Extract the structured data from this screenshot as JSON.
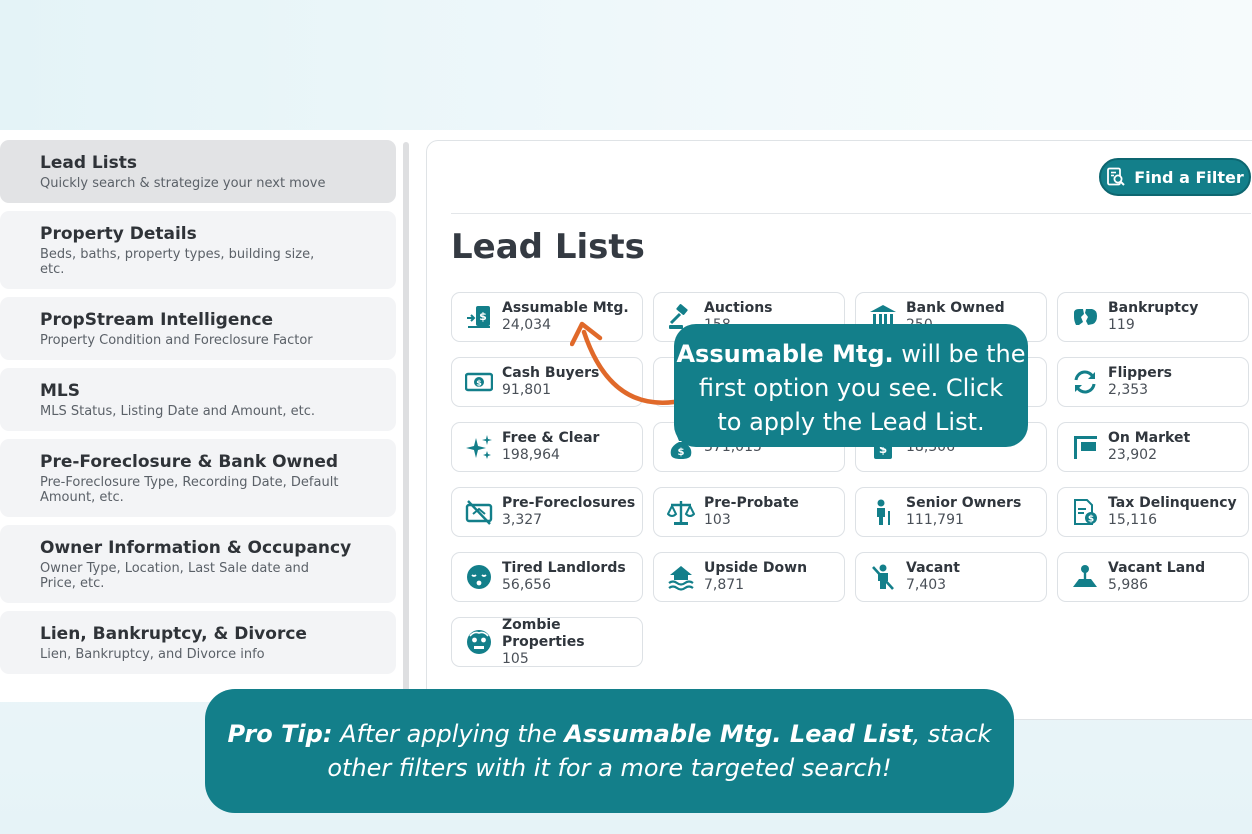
{
  "sidebar": {
    "items": [
      {
        "title": "Lead Lists",
        "sub": "Quickly search & strategize your next move",
        "active": true
      },
      {
        "title": "Property Details",
        "sub": "Beds, baths, property types, building size, etc."
      },
      {
        "title": "PropStream Intelligence",
        "sub": "Property Condition and Foreclosure Factor"
      },
      {
        "title": "MLS",
        "sub": "MLS Status, Listing Date and Amount, etc."
      },
      {
        "title": "Pre-Foreclosure & Bank Owned",
        "sub": "Pre-Foreclosure Type, Recording Date, Default Amount, etc."
      },
      {
        "title": "Owner Information & Occupancy",
        "sub": "Owner Type, Location, Last Sale date and Price, etc."
      },
      {
        "title": "Lien, Bankruptcy, & Divorce",
        "sub": "Lien, Bankruptcy, and Divorce info"
      }
    ]
  },
  "panel": {
    "find_button": "Find a Filter",
    "title": "Lead Lists",
    "cards": [
      {
        "label": "Assumable Mtg.",
        "count": "24,034",
        "icon": "assumable-mortgage-icon"
      },
      {
        "label": "Auctions",
        "count": "158",
        "icon": "gavel-icon"
      },
      {
        "label": "Bank Owned",
        "count": "250",
        "icon": "bank-icon"
      },
      {
        "label": "Bankruptcy",
        "count": "119",
        "icon": "broken-piggy-icon"
      },
      {
        "label": "Cash Buyers",
        "count": "91,801",
        "icon": "cash-icon"
      },
      {
        "label": "",
        "count": "",
        "icon": "hidden-icon"
      },
      {
        "label": "",
        "count": "",
        "icon": "hidden-icon"
      },
      {
        "label": "Flippers",
        "count": "2,353",
        "icon": "refresh-icon"
      },
      {
        "label": "Free & Clear",
        "count": "198,964",
        "icon": "sparkle-icon"
      },
      {
        "label": "",
        "count": "371,015",
        "icon": "money-bag-icon"
      },
      {
        "label": "",
        "count": "18,306",
        "icon": "dollar-doc-icon"
      },
      {
        "label": "On Market",
        "count": "23,902",
        "icon": "sign-icon"
      },
      {
        "label": "Pre-Foreclosures",
        "count": "3,327",
        "icon": "no-house-icon"
      },
      {
        "label": "Pre-Probate",
        "count": "103",
        "icon": "scales-icon"
      },
      {
        "label": "Senior Owners",
        "count": "111,791",
        "icon": "senior-icon"
      },
      {
        "label": "Tax Delinquency",
        "count": "15,116",
        "icon": "tax-doc-icon"
      },
      {
        "label": "Tired Landlords",
        "count": "56,656",
        "icon": "tired-face-icon"
      },
      {
        "label": "Upside Down",
        "count": "7,871",
        "icon": "flood-house-icon"
      },
      {
        "label": "Vacant",
        "count": "7,403",
        "icon": "no-person-icon"
      },
      {
        "label": "Vacant Land",
        "count": "5,986",
        "icon": "land-icon"
      },
      {
        "label": "Zombie Properties",
        "count": "105",
        "icon": "zombie-icon"
      }
    ]
  },
  "callout": {
    "bold": "Assumable Mtg.",
    "line1_rest": " will be the",
    "line2": "first option you see. Click",
    "line3": "to apply the Lead List."
  },
  "pro_tip": {
    "label": "Pro Tip:",
    "text1": " After applying the ",
    "bold": "Assumable Mtg. Lead List",
    "text2": ", stack",
    "line2": "other filters with it for a more targeted search!"
  },
  "colors": {
    "accent": "#137f8a",
    "arrow": "#e0692a"
  }
}
